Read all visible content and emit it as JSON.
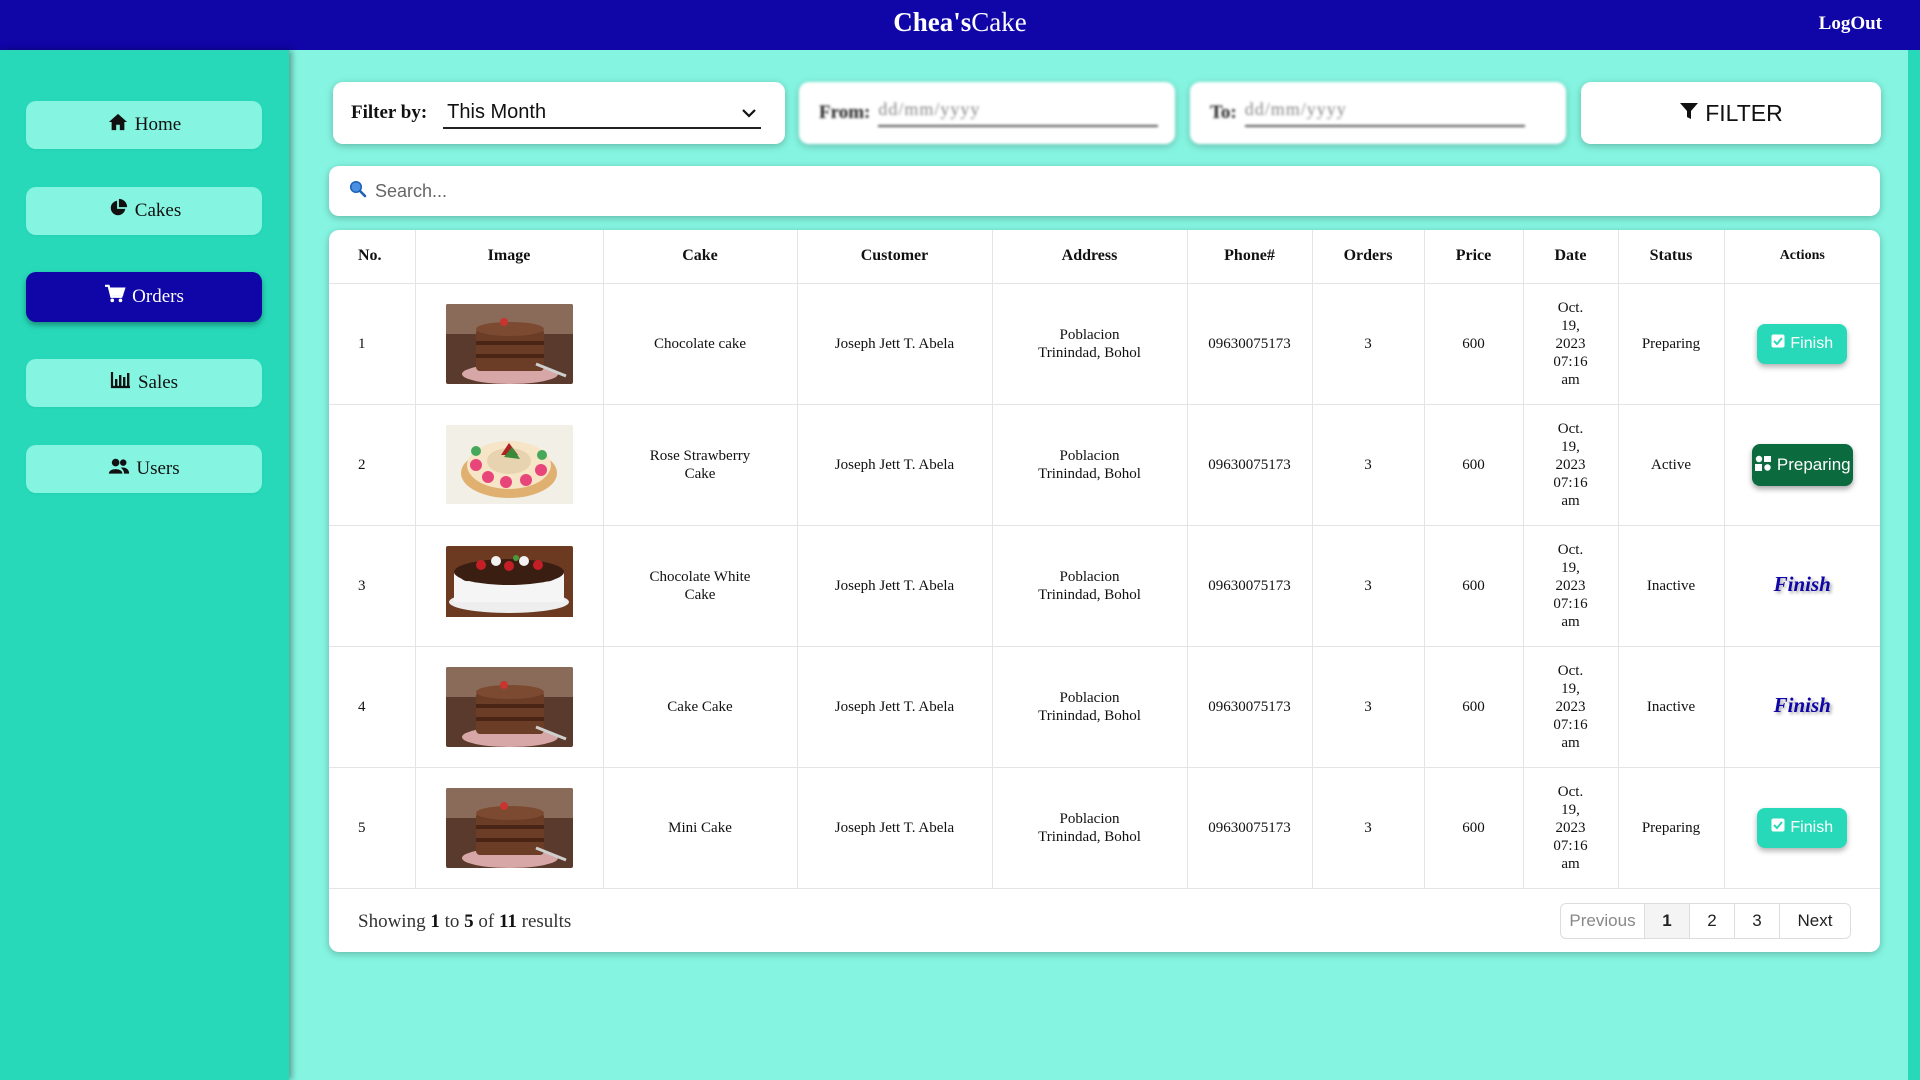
{
  "app": {
    "brand_bold": "Chea's",
    "brand_rest": "Cake",
    "logout_label": "LogOut"
  },
  "sidebar": {
    "items": [
      {
        "label": "Home",
        "icon": "home-icon"
      },
      {
        "label": "Cakes",
        "icon": "pie-chart-icon"
      },
      {
        "label": "Orders",
        "icon": "cart-icon",
        "active": true
      },
      {
        "label": "Sales",
        "icon": "bar-chart-icon"
      },
      {
        "label": "Users",
        "icon": "users-icon"
      }
    ]
  },
  "filter": {
    "label": "Filter by:",
    "selected": "This Month",
    "from_label": "From:",
    "from_placeholder": "dd/mm/yyyy",
    "to_label": "To:",
    "to_placeholder": "dd/mm/yyyy",
    "button_label": "FILTER"
  },
  "search": {
    "placeholder": "Search..."
  },
  "table": {
    "headers": [
      "No.",
      "Image",
      "Cake",
      "Customer",
      "Address",
      "Phone#",
      "Orders",
      "Price",
      "Date",
      "Status",
      "Actions"
    ],
    "rows": [
      {
        "no": "1",
        "image": "chocolate-cake-slice",
        "cake": "Chocolate cake",
        "customer": "Joseph Jett T. Abela",
        "address_1": "Poblacion",
        "address_2": "Trinindad, Bohol",
        "phone": "09630075173",
        "orders": "3",
        "price": "600",
        "date": [
          "Oct.",
          "19,",
          "2023",
          "07:16",
          "am"
        ],
        "status": "Preparing",
        "action": "Finish",
        "action_style": "button"
      },
      {
        "no": "2",
        "image": "rose-strawberry-cake",
        "cake": "Rose Strawberry Cake",
        "customer": "Joseph Jett T. Abela",
        "address_1": "Poblacion",
        "address_2": "Trinindad, Bohol",
        "phone": "09630075173",
        "orders": "3",
        "price": "600",
        "date": [
          "Oct.",
          "19,",
          "2023",
          "07:16",
          "am"
        ],
        "status": "Active",
        "action": "Preparing",
        "action_style": "preparing"
      },
      {
        "no": "3",
        "image": "chocolate-white-cake",
        "cake": "Chocolate White Cake",
        "customer": "Joseph Jett T. Abela",
        "address_1": "Poblacion",
        "address_2": "Trinindad, Bohol",
        "phone": "09630075173",
        "orders": "3",
        "price": "600",
        "date": [
          "Oct.",
          "19,",
          "2023",
          "07:16",
          "am"
        ],
        "status": "Inactive",
        "action": "Finish",
        "action_style": "text"
      },
      {
        "no": "4",
        "image": "chocolate-cake-slice",
        "cake": "Cake Cake",
        "customer": "Joseph Jett T. Abela",
        "address_1": "Poblacion",
        "address_2": "Trinindad, Bohol",
        "phone": "09630075173",
        "orders": "3",
        "price": "600",
        "date": [
          "Oct.",
          "19,",
          "2023",
          "07:16",
          "am"
        ],
        "status": "Inactive",
        "action": "Finish",
        "action_style": "text"
      },
      {
        "no": "5",
        "image": "chocolate-cake-slice",
        "cake": "Mini Cake",
        "customer": "Joseph Jett T. Abela",
        "address_1": "Poblacion",
        "address_2": "Trinindad, Bohol",
        "phone": "09630075173",
        "orders": "3",
        "price": "600",
        "date": [
          "Oct.",
          "19,",
          "2023",
          "07:16",
          "am"
        ],
        "status": "Preparing",
        "action": "Finish",
        "action_style": "button"
      }
    ]
  },
  "footer": {
    "showing_prefix": "Showing",
    "from": "1",
    "to_word": "to",
    "to": "5",
    "of_word": "of",
    "total": "11",
    "suffix": "results",
    "pager": {
      "previous": "Previous",
      "pages": [
        "1",
        "2",
        "3"
      ],
      "current": "1",
      "next": "Next"
    }
  },
  "colors": {
    "header_bg": "#1005a6",
    "sidebar_bg": "#27d9b9",
    "page_bg": "#85f5e1",
    "nav_item_bg": "#85f5e1",
    "finish_button": "#27d9b9",
    "preparing_button": "#0b6b3e"
  }
}
